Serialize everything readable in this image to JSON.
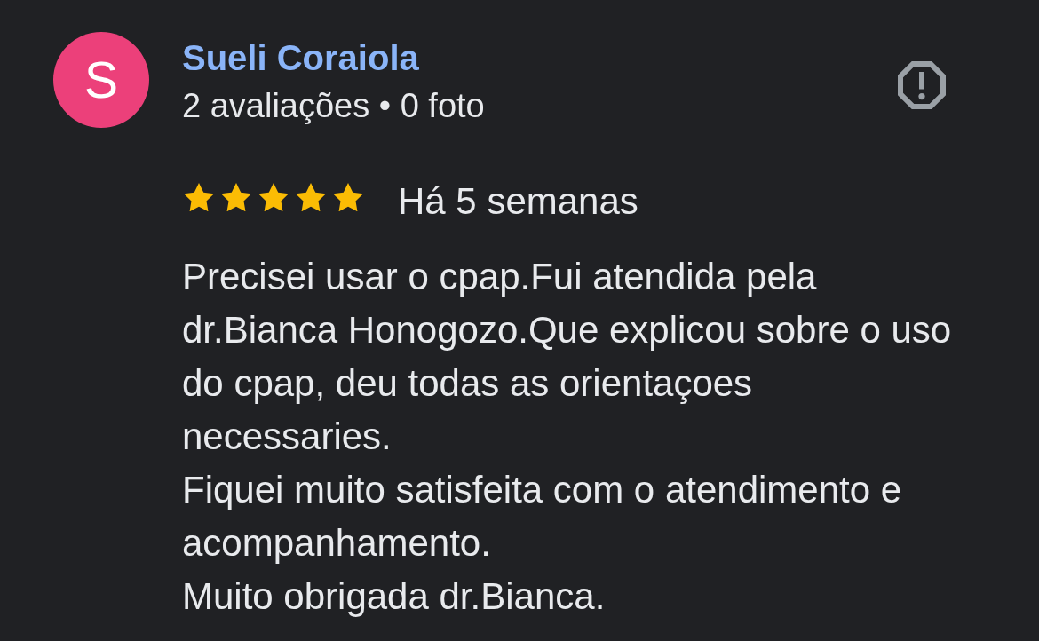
{
  "review": {
    "avatar_initial": "S",
    "author": "Sueli Coraiola",
    "meta": "2 avaliações • 0 foto",
    "stars": 5,
    "date": "Há 5 semanas",
    "text": "Precisei usar o cpap.Fui atendida pela dr.Bianca Honogozo.Que explicou sobre o uso do cpap, deu todas as orientaçoes necessaries.\nFiquei muito satisfeita com o atendimento e acompanhamento.\nMuito obrigada dr.Bianca."
  }
}
